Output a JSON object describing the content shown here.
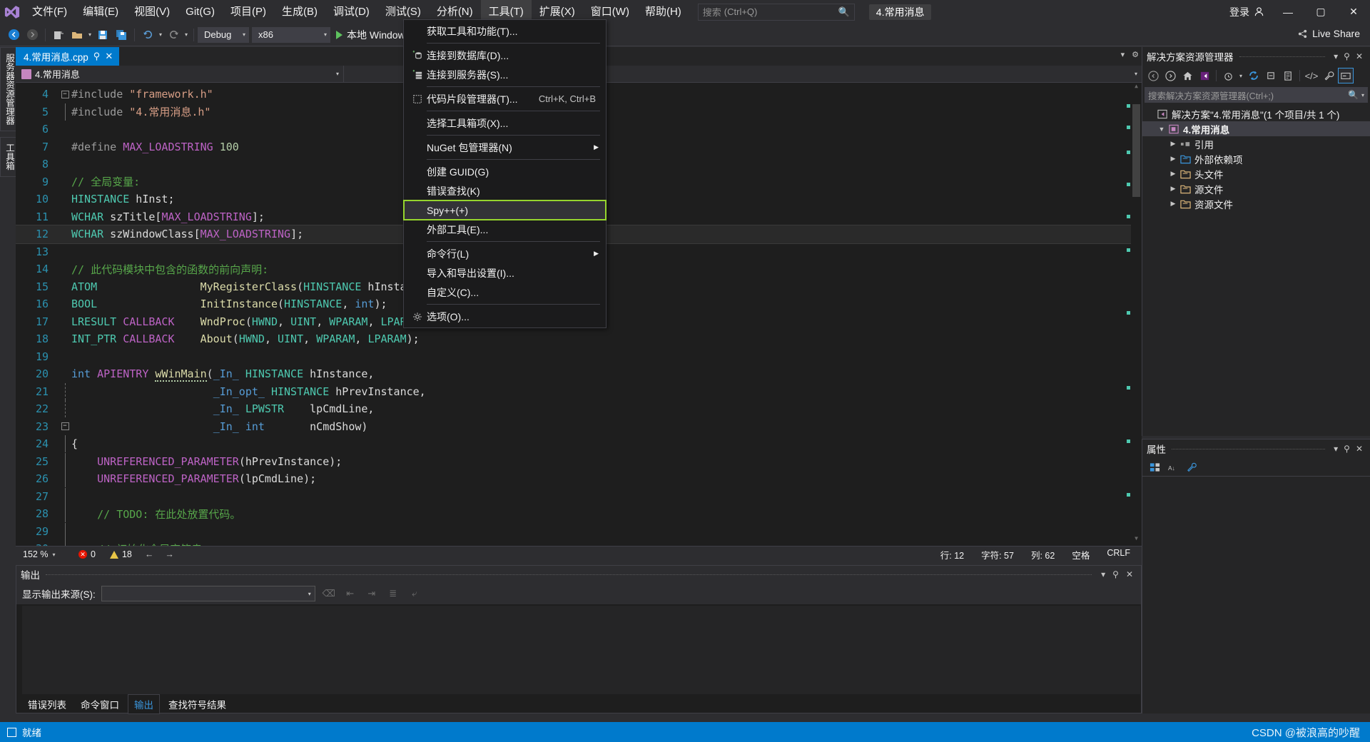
{
  "titlebar": {
    "logo_icon": "visual-studio-logo",
    "menus": [
      {
        "label": "文件(F)"
      },
      {
        "label": "编辑(E)"
      },
      {
        "label": "视图(V)"
      },
      {
        "label": "Git(G)"
      },
      {
        "label": "项目(P)"
      },
      {
        "label": "生成(B)"
      },
      {
        "label": "调试(D)"
      },
      {
        "label": "测试(S)"
      },
      {
        "label": "分析(N)"
      },
      {
        "label": "工具(T)"
      },
      {
        "label": "扩展(X)"
      },
      {
        "label": "窗口(W)"
      },
      {
        "label": "帮助(H)"
      }
    ],
    "search": {
      "label": "搜索",
      "placeholder": "(Ctrl+Q)",
      "icon": "search-icon"
    },
    "project_pill": "4.常用消息",
    "signin": "登录",
    "signin_icon": "account-icon",
    "minimize": "—",
    "maximize": "▢",
    "close": "✕"
  },
  "toolbar": {
    "back_icon": "navigate-back-icon",
    "forward_icon": "navigate-forward-icon",
    "new_icon": "new-project-icon",
    "open_icon": "open-file-icon",
    "save_icon": "save-icon",
    "save_all_icon": "save-all-icon",
    "undo_icon": "undo-icon",
    "redo_icon": "redo-icon",
    "config": "Debug",
    "platform": "x86",
    "run_label": "本地 Windows",
    "run_icon": "play-icon",
    "live_share": "Live Share",
    "live_share_icon": "live-share-icon"
  },
  "left_rail": [
    {
      "label": "服务器资源管理器"
    },
    {
      "label": "工具箱"
    }
  ],
  "editor": {
    "tab": {
      "label": "4.常用消息.cpp",
      "pin_icon": "pin-icon",
      "close_icon": "close-icon"
    },
    "nav_left": "4.常用消息",
    "nav_left_icon": "cpp-file-icon",
    "nav_right": "",
    "status": {
      "zoom": "152 %",
      "errors": "0",
      "warnings": "18",
      "line_label": "行: 12",
      "char_label": "字符: 57",
      "col_label": "列: 62",
      "encoding": "空格",
      "eol": "CRLF"
    },
    "code_lines": [
      {
        "no": "4",
        "fold": "minus",
        "tokens": [
          {
            "t": "#include ",
            "c": "c-pre"
          },
          {
            "t": "\"framework.h\"",
            "c": "c-str"
          }
        ]
      },
      {
        "no": "5",
        "fold": "bar",
        "tokens": [
          {
            "t": "#include ",
            "c": "c-pre"
          },
          {
            "t": "\"4.常用消息.h\"",
            "c": "c-str"
          }
        ]
      },
      {
        "no": "6",
        "fold": "",
        "tokens": []
      },
      {
        "no": "7",
        "fold": "",
        "tokens": [
          {
            "t": "#define ",
            "c": "c-pre"
          },
          {
            "t": "MAX_LOADSTRING",
            "c": "c-macro"
          },
          {
            "t": " ",
            "c": "c-plain"
          },
          {
            "t": "100",
            "c": "c-num"
          }
        ]
      },
      {
        "no": "8",
        "fold": "",
        "tokens": []
      },
      {
        "no": "9",
        "fold": "",
        "tokens": [
          {
            "t": "// 全局变量:",
            "c": "c-cmt"
          }
        ]
      },
      {
        "no": "10",
        "fold": "",
        "tokens": [
          {
            "t": "HINSTANCE",
            "c": "c-type"
          },
          {
            "t": " hInst;",
            "c": "c-plain"
          }
        ]
      },
      {
        "no": "11",
        "fold": "",
        "tokens": [
          {
            "t": "WCHAR",
            "c": "c-type"
          },
          {
            "t": " szTitle[",
            "c": "c-plain"
          },
          {
            "t": "MAX_LOADSTRING",
            "c": "c-macro"
          },
          {
            "t": "];",
            "c": "c-plain"
          }
        ]
      },
      {
        "no": "12",
        "fold": "",
        "selected": true,
        "tokens": [
          {
            "t": "WCHAR",
            "c": "c-type"
          },
          {
            "t": " szWindowClass[",
            "c": "c-plain"
          },
          {
            "t": "MAX_LOADSTRING",
            "c": "c-macro"
          },
          {
            "t": "];",
            "c": "c-plain"
          }
        ]
      },
      {
        "no": "13",
        "fold": "",
        "tokens": []
      },
      {
        "no": "14",
        "fold": "",
        "tokens": [
          {
            "t": "// 此代码模块中包含的函数的前向声明:",
            "c": "c-cmt"
          }
        ]
      },
      {
        "no": "15",
        "fold": "",
        "tokens": [
          {
            "t": "ATOM",
            "c": "c-type"
          },
          {
            "t": "                ",
            "c": "c-plain"
          },
          {
            "t": "MyRegisterClass",
            "c": "c-fn"
          },
          {
            "t": "(",
            "c": "c-pun"
          },
          {
            "t": "HINSTANCE",
            "c": "c-type"
          },
          {
            "t": " hInstance);",
            "c": "c-plain"
          }
        ]
      },
      {
        "no": "16",
        "fold": "",
        "tokens": [
          {
            "t": "BOOL",
            "c": "c-type"
          },
          {
            "t": "                ",
            "c": "c-plain"
          },
          {
            "t": "InitInstance",
            "c": "c-fn"
          },
          {
            "t": "(",
            "c": "c-pun"
          },
          {
            "t": "HINSTANCE",
            "c": "c-type"
          },
          {
            "t": ", ",
            "c": "c-plain"
          },
          {
            "t": "int",
            "c": "c-kw"
          },
          {
            "t": ");",
            "c": "c-plain"
          }
        ]
      },
      {
        "no": "17",
        "fold": "",
        "tokens": [
          {
            "t": "LRESULT",
            "c": "c-type"
          },
          {
            "t": " ",
            "c": "c-plain"
          },
          {
            "t": "CALLBACK",
            "c": "c-macro"
          },
          {
            "t": "    ",
            "c": "c-plain"
          },
          {
            "t": "WndProc",
            "c": "c-fn"
          },
          {
            "t": "(",
            "c": "c-pun"
          },
          {
            "t": "HWND",
            "c": "c-type"
          },
          {
            "t": ", ",
            "c": "c-plain"
          },
          {
            "t": "UINT",
            "c": "c-type"
          },
          {
            "t": ", ",
            "c": "c-plain"
          },
          {
            "t": "WPARAM",
            "c": "c-type"
          },
          {
            "t": ", ",
            "c": "c-plain"
          },
          {
            "t": "LPARAM",
            "c": "c-type"
          },
          {
            "t": ");",
            "c": "c-plain"
          }
        ]
      },
      {
        "no": "18",
        "fold": "",
        "tokens": [
          {
            "t": "INT_PTR",
            "c": "c-type"
          },
          {
            "t": " ",
            "c": "c-plain"
          },
          {
            "t": "CALLBACK",
            "c": "c-macro"
          },
          {
            "t": "    ",
            "c": "c-plain"
          },
          {
            "t": "About",
            "c": "c-fn"
          },
          {
            "t": "(",
            "c": "c-pun"
          },
          {
            "t": "HWND",
            "c": "c-type"
          },
          {
            "t": ", ",
            "c": "c-plain"
          },
          {
            "t": "UINT",
            "c": "c-type"
          },
          {
            "t": ", ",
            "c": "c-plain"
          },
          {
            "t": "WPARAM",
            "c": "c-type"
          },
          {
            "t": ", ",
            "c": "c-plain"
          },
          {
            "t": "LPARAM",
            "c": "c-type"
          },
          {
            "t": ");",
            "c": "c-plain"
          }
        ]
      },
      {
        "no": "19",
        "fold": "",
        "tokens": []
      },
      {
        "no": "20",
        "fold": "",
        "tokens": [
          {
            "t": "int",
            "c": "c-kw"
          },
          {
            "t": " ",
            "c": "c-plain"
          },
          {
            "t": "APIENTRY",
            "c": "c-macro"
          },
          {
            "t": " ",
            "c": "c-plain"
          },
          {
            "t": "wWinMain",
            "c": "c-fn squiggle"
          },
          {
            "t": "(",
            "c": "c-pun"
          },
          {
            "t": "_In_",
            "c": "c-kw"
          },
          {
            "t": " ",
            "c": "c-plain"
          },
          {
            "t": "HINSTANCE",
            "c": "c-type"
          },
          {
            "t": " hInstance,",
            "c": "c-plain"
          }
        ]
      },
      {
        "no": "21",
        "fold": "dots",
        "tokens": [
          {
            "t": "                      ",
            "c": "c-plain"
          },
          {
            "t": "_In_opt_",
            "c": "c-kw"
          },
          {
            "t": " ",
            "c": "c-plain"
          },
          {
            "t": "HINSTANCE",
            "c": "c-type"
          },
          {
            "t": " hPrevInstance,",
            "c": "c-plain"
          }
        ]
      },
      {
        "no": "22",
        "fold": "dots",
        "tokens": [
          {
            "t": "                      ",
            "c": "c-plain"
          },
          {
            "t": "_In_",
            "c": "c-kw"
          },
          {
            "t": " ",
            "c": "c-plain"
          },
          {
            "t": "LPWSTR",
            "c": "c-type"
          },
          {
            "t": "    lpCmdLine,",
            "c": "c-plain"
          }
        ]
      },
      {
        "no": "23",
        "fold": "minus2",
        "tokens": [
          {
            "t": "                      ",
            "c": "c-plain"
          },
          {
            "t": "_In_",
            "c": "c-kw"
          },
          {
            "t": " ",
            "c": "c-plain"
          },
          {
            "t": "int",
            "c": "c-kw"
          },
          {
            "t": "       nCmdShow)",
            "c": "c-plain"
          }
        ]
      },
      {
        "no": "24",
        "fold": "bar",
        "tokens": [
          {
            "t": "{",
            "c": "c-plain"
          }
        ]
      },
      {
        "no": "25",
        "fold": "bar",
        "tokens": [
          {
            "t": "    ",
            "c": "c-plain"
          },
          {
            "t": "UNREFERENCED_PARAMETER",
            "c": "c-macro"
          },
          {
            "t": "(hPrevInstance);",
            "c": "c-plain"
          }
        ]
      },
      {
        "no": "26",
        "fold": "bar",
        "tokens": [
          {
            "t": "    ",
            "c": "c-plain"
          },
          {
            "t": "UNREFERENCED_PARAMETER",
            "c": "c-macro"
          },
          {
            "t": "(lpCmdLine);",
            "c": "c-plain"
          }
        ]
      },
      {
        "no": "27",
        "fold": "bar",
        "tokens": []
      },
      {
        "no": "28",
        "fold": "bar",
        "tokens": [
          {
            "t": "    ",
            "c": "c-plain"
          },
          {
            "t": "// TODO: 在此处放置代码。",
            "c": "c-cmt"
          }
        ]
      },
      {
        "no": "29",
        "fold": "bar",
        "tokens": []
      },
      {
        "no": "30",
        "fold": "bar",
        "tokens": [
          {
            "t": "    ",
            "c": "c-plain"
          },
          {
            "t": "// 初始化全局字符串",
            "c": "c-cmt"
          }
        ]
      }
    ]
  },
  "tools_menu": {
    "items": [
      {
        "label": "获取工具和功能(T)...",
        "icon": "",
        "keys": "",
        "submenu": false
      },
      {
        "sep": true
      },
      {
        "label": "连接到数据库(D)...",
        "icon": "database-icon",
        "keys": "",
        "submenu": false
      },
      {
        "label": "连接到服务器(S)...",
        "icon": "server-icon",
        "keys": "",
        "submenu": false
      },
      {
        "sep": true
      },
      {
        "label": "代码片段管理器(T)...",
        "icon": "snippet-icon",
        "keys": "Ctrl+K, Ctrl+B",
        "submenu": false
      },
      {
        "sep": true
      },
      {
        "label": "选择工具箱项(X)...",
        "icon": "",
        "keys": "",
        "submenu": false
      },
      {
        "sep": true
      },
      {
        "label": "NuGet 包管理器(N)",
        "icon": "",
        "keys": "",
        "submenu": true
      },
      {
        "sep": true
      },
      {
        "label": "创建 GUID(G)",
        "icon": "",
        "keys": "",
        "submenu": false
      },
      {
        "label": "错误查找(K)",
        "icon": "",
        "keys": "",
        "submenu": false
      },
      {
        "label": "Spy++(+)",
        "icon": "",
        "keys": "",
        "submenu": false,
        "highlight": true
      },
      {
        "label": "外部工具(E)...",
        "icon": "",
        "keys": "",
        "submenu": false
      },
      {
        "sep": true
      },
      {
        "label": "命令行(L)",
        "icon": "",
        "keys": "",
        "submenu": true
      },
      {
        "label": "导入和导出设置(I)...",
        "icon": "",
        "keys": "",
        "submenu": false
      },
      {
        "label": "自定义(C)...",
        "icon": "",
        "keys": "",
        "submenu": false
      },
      {
        "sep": true
      },
      {
        "label": "选项(O)...",
        "icon": "gear-icon",
        "keys": "",
        "submenu": false
      }
    ],
    "highlight_color": "#96d52e"
  },
  "solution_explorer": {
    "title": "解决方案资源管理器",
    "dropdown_icon": "chevron-down-icon",
    "pin_icon": "pin-icon",
    "close_icon": "close-icon",
    "toolbar_icons": [
      "back-icon",
      "forward-icon",
      "home-icon",
      "solution-icon",
      "pending-changes-icon",
      "refresh-icon",
      "collapse-all-icon",
      "properties-icon",
      "show-all-files-icon",
      "wrench-icon",
      "preview-icon"
    ],
    "search_placeholder": "搜索解决方案资源管理器(Ctrl+;)",
    "search_icon": "search-icon",
    "tree": [
      {
        "indent": 0,
        "tri": "",
        "icon": "solution-icon",
        "label": "解决方案\"4.常用消息\"(1 个项目/共 1 个)",
        "selected": false
      },
      {
        "indent": 1,
        "tri": "▼",
        "icon": "cpp-project-icon",
        "label": "4.常用消息",
        "selected": true,
        "bold": true
      },
      {
        "indent": 2,
        "tri": "▶",
        "icon": "references-icon",
        "label": "引用",
        "selected": false
      },
      {
        "indent": 2,
        "tri": "▶",
        "icon": "external-deps-icon",
        "label": "外部依赖项",
        "selected": false
      },
      {
        "indent": 2,
        "tri": "▶",
        "icon": "folder-icon",
        "label": "头文件",
        "selected": false
      },
      {
        "indent": 2,
        "tri": "▶",
        "icon": "folder-icon",
        "label": "源文件",
        "selected": false
      },
      {
        "indent": 2,
        "tri": "▶",
        "icon": "folder-icon",
        "label": "资源文件",
        "selected": false
      }
    ]
  },
  "properties": {
    "title": "属性",
    "dropdown_icon": "chevron-down-icon",
    "pin_icon": "pin-icon",
    "close_icon": "close-icon",
    "toolbar_icons": [
      "categorized-icon",
      "alphabetical-icon",
      "properties-icon"
    ]
  },
  "output": {
    "title": "输出",
    "dropdown_icon": "chevron-down-icon",
    "pin_icon": "pin-icon",
    "close_icon": "close-icon",
    "source_label": "显示输出来源(S):",
    "source_value": "",
    "toolbar_icons": [
      "clear-icon",
      "prev-icon",
      "next-icon",
      "wordwrap-icon",
      "toggle-icon"
    ],
    "tabs": [
      {
        "label": "错误列表",
        "selected": false
      },
      {
        "label": "命令窗口",
        "selected": false
      },
      {
        "label": "输出",
        "selected": true
      },
      {
        "label": "查找符号结果",
        "selected": false
      }
    ]
  },
  "statusbar": {
    "ready": "就绪",
    "ready_icon": "status-square-icon",
    "watermark": "CSDN @被浪高的吵醒"
  }
}
